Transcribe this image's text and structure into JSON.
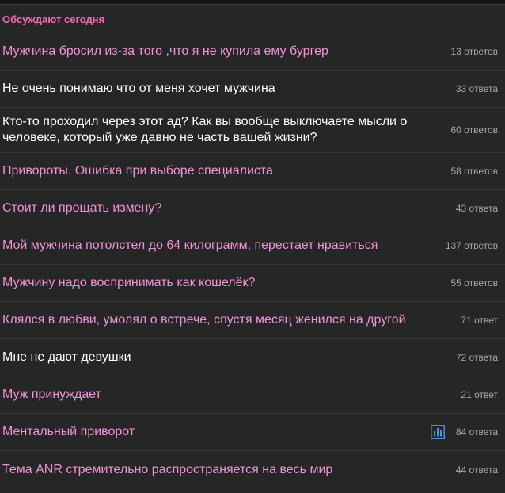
{
  "section": {
    "title": "Обсуждают сегодня"
  },
  "colors": {
    "accent": "#f06bb4",
    "unread_title": "#ef93d6",
    "read_title": "#ffffff",
    "count": "#a8a8a8",
    "background": "#262626",
    "poll_icon": "#4a90d9"
  },
  "topics": [
    {
      "title": "Мужчина бросил из-за того ,что я не купила ему бургер",
      "count": "13 ответов",
      "read": false
    },
    {
      "title": "Не очень понимаю что от меня хочет мужчина",
      "count": "33 ответа",
      "read": true
    },
    {
      "title": "Кто-то проходил через этот ад? Как вы вообще выключаете мысли о человеке, который уже давно не часть вашей жизни?",
      "count": "60 ответов",
      "read": true
    },
    {
      "title": "Привороты. Ошибка при выборе специалиста",
      "count": "58 ответов",
      "read": false
    },
    {
      "title": "Стоит ли прощать измену?",
      "count": "43 ответа",
      "read": false
    },
    {
      "title": "Мой мужчина потолстел до 64 килограмм, перестает нравиться",
      "count": "137 ответов",
      "read": false
    },
    {
      "title": "Мужчину надо воспринимать как кошелёк?",
      "count": "55 ответов",
      "read": false
    },
    {
      "title": "Клялся в любви, умолял о встрече, спустя месяц женился на другой",
      "count": "71 ответ",
      "read": false
    },
    {
      "title": "Мне не дают девушки",
      "count": "72 ответа",
      "read": true
    },
    {
      "title": "Муж принуждает",
      "count": "21 ответ",
      "read": false
    },
    {
      "title": "Ментальный приворот",
      "count": "84 ответа",
      "read": false,
      "icon": "poll-chart-icon"
    },
    {
      "title": "Тема ANR стремительно распространяется на весь мир",
      "count": "44 ответа",
      "read": false
    }
  ]
}
